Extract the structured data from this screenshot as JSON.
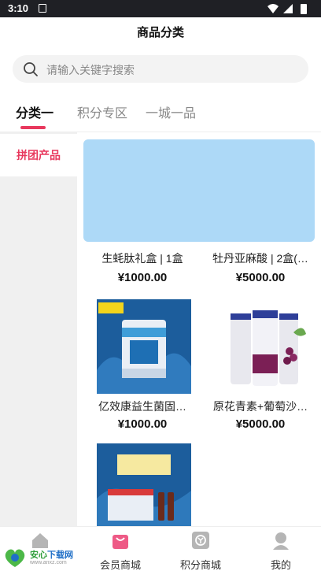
{
  "status_bar": {
    "time": "3:10"
  },
  "header": {
    "title": "商品分类"
  },
  "search": {
    "placeholder": "请输入关键字搜索"
  },
  "tabs": [
    {
      "label": "分类一",
      "active": true
    },
    {
      "label": "积分专区",
      "active": false
    },
    {
      "label": "一城一品",
      "active": false
    }
  ],
  "sidebar": {
    "items": [
      {
        "label": "拼团产品",
        "active": true
      }
    ]
  },
  "products": [
    {
      "name": "生蚝肽礼盒 | 1盒",
      "price": "¥1000.00"
    },
    {
      "name": "牡丹亚麻酸 | 2盒(…",
      "price": "¥5000.00"
    },
    {
      "name": "亿效康益生菌固…",
      "price": "¥1000.00"
    },
    {
      "name": "原花青素+葡萄沙…",
      "price": "¥5000.00"
    }
  ],
  "tabbar": {
    "items": [
      {
        "label": ""
      },
      {
        "label": "会员商城"
      },
      {
        "label": "积分商城"
      },
      {
        "label": "我的"
      }
    ]
  },
  "watermark": {
    "name_a": "安心",
    "name_b": "下载网",
    "url": "www.anxz.com",
    "logo_text": "安心"
  },
  "colors": {
    "accent": "#e8385d",
    "banner": "#add9f7",
    "sidebar_bg": "#f0f0f0",
    "status_bar": "#1f2025"
  }
}
